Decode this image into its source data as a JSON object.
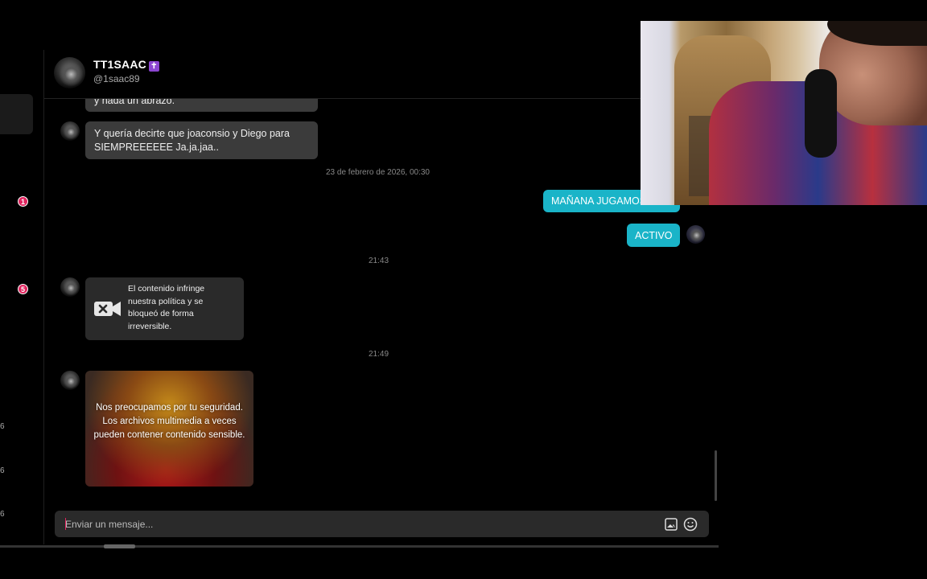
{
  "contact": {
    "name": "TT1SAAC",
    "verified_symbol": "✝",
    "handle": "@1saac89"
  },
  "sidebar": {
    "badges": [
      "1",
      "5"
    ],
    "stray_digits": [
      "6",
      "6",
      "6"
    ]
  },
  "messages": {
    "partial_top": "y nada un abrazo.",
    "incoming_1": "Y quería decirte que joaconsio y Diego para SIEMPREEEEEE Ja.ja.jaa..",
    "timestamp_1": "23 de febrero de 2026, 00:30",
    "outgoing_1": "MAÑANA JUGAMOS",
    "outgoing_2": "ACTIVO",
    "timestamp_2": "21:43",
    "blocked_notice": "El contenido infringe nuestra política y se bloqueó de forma irreversible.",
    "timestamp_3": "21:49",
    "sensitive_notice": "Nos preocupamos por tu seguridad. Los archivos multimedia a veces pueden contener contenido sensible."
  },
  "composer": {
    "placeholder": "Enviar un mensaje...",
    "value": ""
  },
  "colors": {
    "background": "#000000",
    "incoming_bubble": "#3b3b3b",
    "outgoing_bubble": "#1ab4c8",
    "badge": "#e0245e",
    "verified": "#8b45d0"
  },
  "icons": {
    "blocked_media": "video-blocked-icon",
    "image_picker": "image-icon",
    "emoji": "emoji-icon"
  }
}
